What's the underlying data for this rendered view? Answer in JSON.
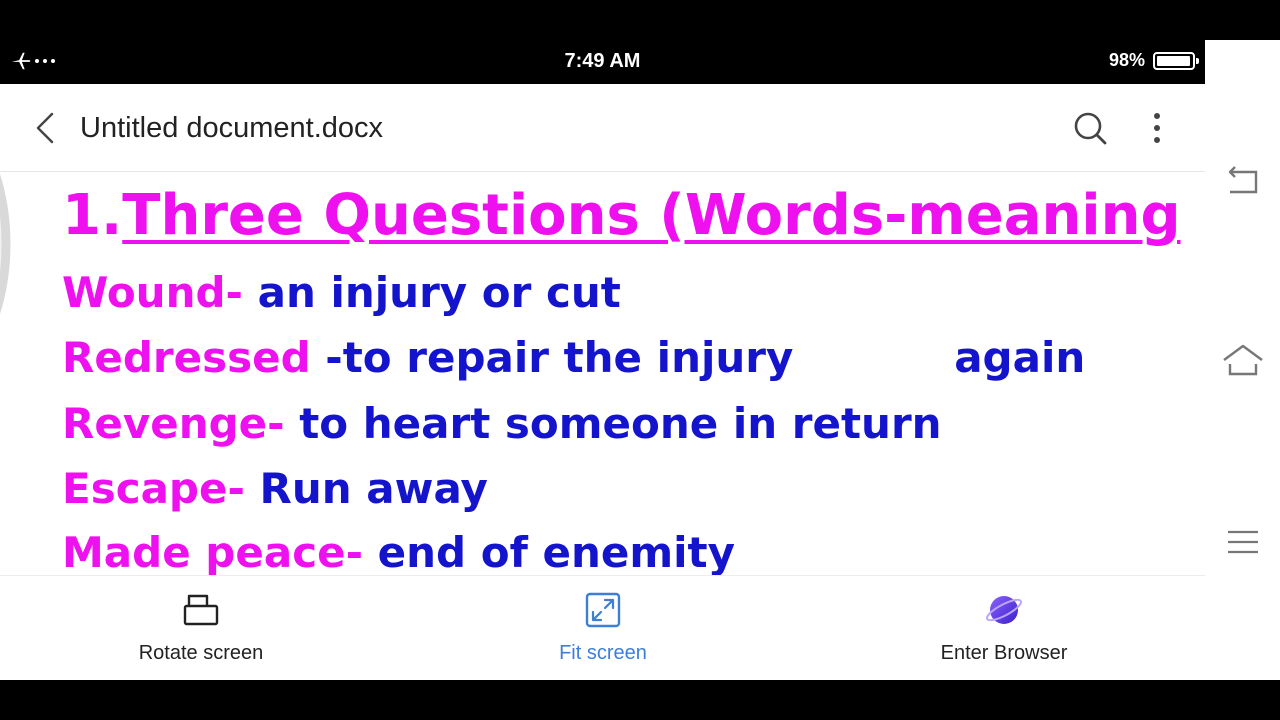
{
  "status_bar": {
    "time": "7:49 AM",
    "battery_text": "98%",
    "battery_level": 0.98,
    "icons": [
      "airplane-icon",
      "more-notifications-icon",
      "battery-icon"
    ]
  },
  "top_bar": {
    "title": "Untitled document.docx",
    "icons": [
      "back-icon",
      "search-icon",
      "more-vert-icon"
    ]
  },
  "document": {
    "heading_number": "1.",
    "heading_text": "Three Questions (Words-meaning",
    "entries": [
      {
        "term": "Wound-",
        "definition": " an injury or cut"
      },
      {
        "term": "Redressed",
        "definition": " -to repair the injury           again"
      },
      {
        "term": "Revenge-",
        "definition": " to heart someone in return"
      },
      {
        "term": "Escape-",
        "definition": " Run away"
      },
      {
        "term": "Made peace-",
        "definition": " end of enemity"
      }
    ],
    "colors": {
      "term": "#ee10ee",
      "definition": "#1414cc"
    }
  },
  "bottom_bar": {
    "rotate_label": "Rotate screen",
    "fit_label": "Fit screen",
    "browser_label": "Enter Browser",
    "icons": [
      "rotate-screen-icon",
      "fit-screen-icon",
      "browser-planet-icon"
    ]
  },
  "nav_side": {
    "icons": [
      "nav-back-icon",
      "nav-home-icon",
      "nav-menu-icon"
    ]
  }
}
